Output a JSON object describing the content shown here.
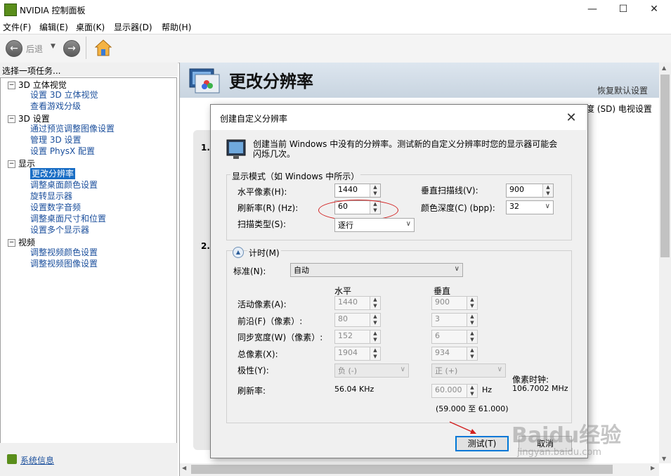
{
  "window": {
    "title": "NVIDIA 控制面板",
    "minimize_glyph": "—",
    "maximize_glyph": "☐",
    "close_glyph": "✕"
  },
  "menu": [
    "文件(F)",
    "编辑(E)",
    "桌面(K)",
    "显示器(D)",
    "帮助(H)"
  ],
  "toolbar": {
    "back_label": "后退",
    "back_icon": "arrow-left-icon",
    "forward_icon": "arrow-right-icon",
    "home_icon": "home-icon"
  },
  "sidebar": {
    "header": "选择一项任务...",
    "tree": [
      {
        "label": "3D 立体视觉",
        "level": 0
      },
      {
        "label": "设置 3D 立体视觉",
        "level": 1
      },
      {
        "label": "查看游戏分级",
        "level": 1
      },
      {
        "label": "3D 设置",
        "level": 0
      },
      {
        "label": "通过预览调整图像设置",
        "level": 1
      },
      {
        "label": "管理 3D 设置",
        "level": 1
      },
      {
        "label": "设置 PhysX 配置",
        "level": 1
      },
      {
        "label": "显示",
        "level": 0
      },
      {
        "label": "更改分辨率",
        "level": 1,
        "selected": true
      },
      {
        "label": "调整桌面颜色设置",
        "level": 1
      },
      {
        "label": "旋转显示器",
        "level": 1
      },
      {
        "label": "设置数字音频",
        "level": 1
      },
      {
        "label": "调整桌面尺寸和位置",
        "level": 1
      },
      {
        "label": "设置多个显示器",
        "level": 1
      },
      {
        "label": "视频",
        "level": 0
      },
      {
        "label": "调整视频颜色设置",
        "level": 1
      },
      {
        "label": "调整视频图像设置",
        "level": 1
      }
    ],
    "system_info": "系统信息"
  },
  "main": {
    "title": "更改分辨率",
    "restore_defaults": "恢复默认设置",
    "partial_text": "度 (SD) 电视设置",
    "step1": "1.",
    "step2": "2."
  },
  "dialog": {
    "title": "创建自定义分辨率",
    "description": "创建当前 Windows 中没有的分辨率。测试新的自定义分辨率时您的显示器可能会闪烁几次。",
    "display_mode_group": "显示模式（如 Windows 中所示）",
    "horizontal_pixels_label": "水平像素(H):",
    "horizontal_pixels": "1440",
    "vertical_lines_label": "垂直扫描线(V):",
    "vertical_lines": "900",
    "refresh_rate_label": "刷新率(R) (Hz):",
    "refresh_rate": "60",
    "color_depth_label": "颜色深度(C) (bpp):",
    "color_depth": "32",
    "scan_type_label": "扫描类型(S):",
    "scan_type": "逐行",
    "timing_label": "计时(M)",
    "standard_label": "标准(N):",
    "standard": "自动",
    "col_horizontal": "水平",
    "col_vertical": "垂直",
    "active_pixels_label": "活动像素(A):",
    "active_h": "1440",
    "active_v": "900",
    "front_porch_label": "前沿(F)（像素）:",
    "front_h": "80",
    "front_v": "3",
    "sync_width_label": "同步宽度(W)（像素）:",
    "sync_h": "152",
    "sync_v": "6",
    "total_pixels_label": "总像素(X):",
    "total_h": "1904",
    "total_v": "934",
    "polarity_label": "极性(Y):",
    "polarity_h": "负 (-)",
    "polarity_v": "正 (+)",
    "pixel_clock_label": "像素时钟:",
    "pixel_clock": "106.7002 MHz",
    "refresh_label": "刷新率:",
    "refresh_h": "56.04 KHz",
    "refresh_v": "60.000",
    "refresh_v_unit": "Hz",
    "refresh_range": "(59.000 至 61.000)",
    "test_button": "测试(T)",
    "cancel_button": "取消"
  },
  "watermark": {
    "brand": "Baidu经验",
    "url": "jingyan.baidu.com"
  },
  "colors": {
    "selected": "#1a6ec5",
    "link": "#1b4f9c",
    "annotation": "#d22020"
  }
}
